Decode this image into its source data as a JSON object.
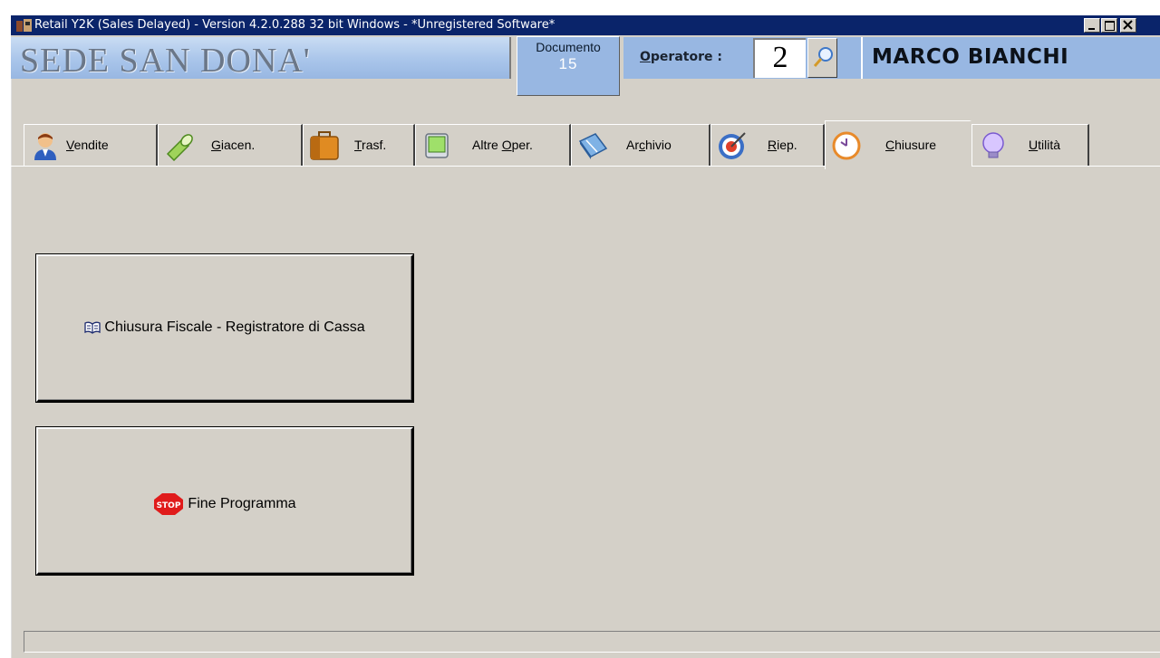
{
  "window": {
    "title": "Retail Y2K (Sales Delayed)  -  Version 4.2.0.288  32 bit Windows - *Unregistered Software*",
    "controls": {
      "minimize": "_",
      "maximize": "□",
      "close": "✕"
    }
  },
  "header": {
    "sede": "SEDE SAN DONA'",
    "documento_label": "Documento",
    "documento_value": "15",
    "operatore_label_prefix": "O",
    "operatore_label_rest": "peratore :",
    "operatore_value": "2",
    "operatore_name": "MARCO BIANCHI"
  },
  "tabs": [
    {
      "u": "V",
      "rest": "endite",
      "icon": "user-icon"
    },
    {
      "pre": "",
      "u": "G",
      "rest": "iacen.",
      "icon": "flashlight-icon"
    },
    {
      "u": "T",
      "rest": "rasf.",
      "icon": "briefcase-icon"
    },
    {
      "pre": "Altre ",
      "u": "O",
      "rest": "per.",
      "icon": "handheld-device-icon"
    },
    {
      "pre": "Ar",
      "u": "c",
      "rest": "hivio",
      "icon": "book-icon"
    },
    {
      "u": "R",
      "rest": "iep.",
      "icon": "target-icon"
    },
    {
      "u": "C",
      "rest": "hiusure",
      "icon": "clock-icon"
    },
    {
      "u": "U",
      "rest": "tilità",
      "icon": "lightbulb-icon"
    }
  ],
  "active_tab": "Chiusure",
  "buttons": {
    "chiusura": {
      "label": "Chiusura Fiscale - Registratore di Cassa",
      "icon": "open-book-icon"
    },
    "fine": {
      "label": "Fine Programma",
      "icon": "stop-sign-icon",
      "icon_text": "STOP"
    }
  },
  "status_text": ""
}
